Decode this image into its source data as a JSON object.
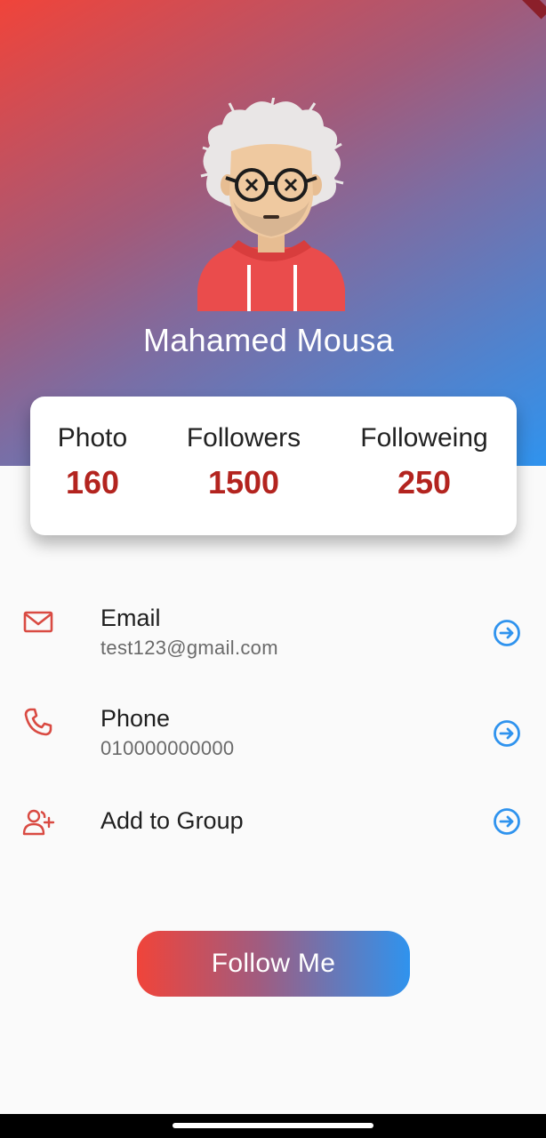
{
  "profile": {
    "name": "Mahamed Mousa"
  },
  "stats": [
    {
      "label": "Photo",
      "value": "160"
    },
    {
      "label": "Followers",
      "value": "1500"
    },
    {
      "label": "Followeing",
      "value": "250"
    }
  ],
  "rows": [
    {
      "title": "Email",
      "subtitle": "test123@gmail.com",
      "icon": "mail-icon"
    },
    {
      "title": "Phone",
      "subtitle": "010000000000",
      "icon": "phone-icon"
    },
    {
      "title": "Add to Group",
      "icon": "add-user-icon"
    }
  ],
  "follow_button": {
    "label": "Follow Me"
  },
  "colors": {
    "accent_red": "#b3241f",
    "icon_red": "#d94a42",
    "arrow_blue": "#2f93ee",
    "gradient_start": "#f0443a",
    "gradient_end": "#2f93ee"
  }
}
